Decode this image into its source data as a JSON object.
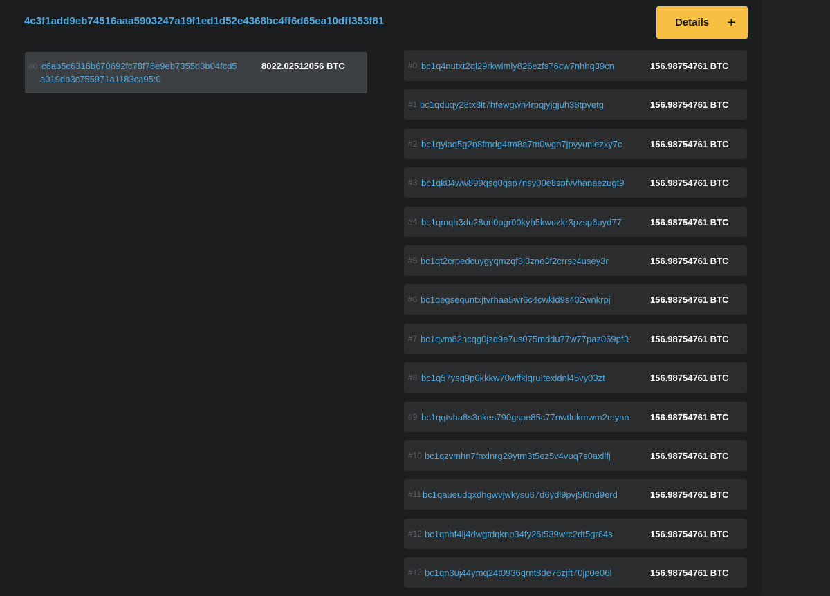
{
  "transaction": {
    "txid": "4c3f1add9eb74516aaa5903247a19f1ed1d52e4368bc4ff6d65ea10dff353f81",
    "details_label": "Details",
    "details_icon": "plus-icon"
  },
  "input": {
    "index": "#0",
    "prev_tx_line1": "c6ab5c6318b670692fc78f78e9eb7355d3b04fcd5",
    "prev_tx_line2": "a019db3c755971a1183ca95:0",
    "amount": "8022.02512056 BTC"
  },
  "outputs": [
    {
      "index": "#0",
      "address": "bc1q4nutxt2ql29rkwlmly826ezfs76cw7nhhq39cn",
      "amount": "156.98754761 BTC"
    },
    {
      "index": "#1",
      "address": "bc1qduqy28tx8lt7hfewgwn4rpqjyjgjuh38tpvetg",
      "amount": "156.98754761 BTC"
    },
    {
      "index": "#2",
      "address": "bc1qylaq5g2n8fmdg4tm8a7m0wgn7jpyyunlezxy7c",
      "amount": "156.98754761 BTC"
    },
    {
      "index": "#3",
      "address": "bc1qk04ww899qsq0qsp7nsy00e8spfvvhanaezugt9",
      "amount": "156.98754761 BTC"
    },
    {
      "index": "#4",
      "address": "bc1qmqh3du28url0pgr00kyh5kwuzkr3pzsp6uyd77",
      "amount": "156.98754761 BTC"
    },
    {
      "index": "#5",
      "address": "bc1qt2crpedcuygyqmzqf3j3zne3f2crrsc4usey3r",
      "amount": "156.98754761 BTC"
    },
    {
      "index": "#6",
      "address": "bc1qegsequntxjtvrhaa5wr6c4cwkld9s402wnkrpj",
      "amount": "156.98754761 BTC"
    },
    {
      "index": "#7",
      "address": "bc1qvm82ncqg0jzd9e7us075mddu77w77paz069pf3",
      "amount": "156.98754761 BTC"
    },
    {
      "index": "#8",
      "address": "bc1q57ysq9p0kkkw70wffklqruItexldnl45vy03zt",
      "amount": "156.98754761 BTC"
    },
    {
      "index": "#9",
      "address": "bc1qqtvha8s3nkes790gspe85c77nwtlukmwm2mynn",
      "amount": "156.98754761 BTC"
    },
    {
      "index": "#10",
      "address": "bc1qzvmhn7fnxlnrg29ytm3t5ez5v4vuq7s0axllfj",
      "amount": "156.98754761 BTC"
    },
    {
      "index": "#11",
      "address": "bc1qaueudqxdhgwvjwkysu67d6ydl9pvj5l0nd9erd",
      "amount": "156.98754761 BTC"
    },
    {
      "index": "#12",
      "address": "bc1qnhf4lj4dwgtdqknp34fy26t539wrc2dt5gr64s",
      "amount": "156.98754761 BTC"
    },
    {
      "index": "#13",
      "address": "bc1qn3uj44ymq24t0936qrnt8de76zjft70jp0e06l",
      "amount": "156.98754761 BTC"
    }
  ],
  "colors": {
    "background": "#1b1d1f",
    "link": "#4ea8de",
    "accent": "#f8c042",
    "row_background": "#2a2c2e",
    "input_background": "#3d4043"
  }
}
